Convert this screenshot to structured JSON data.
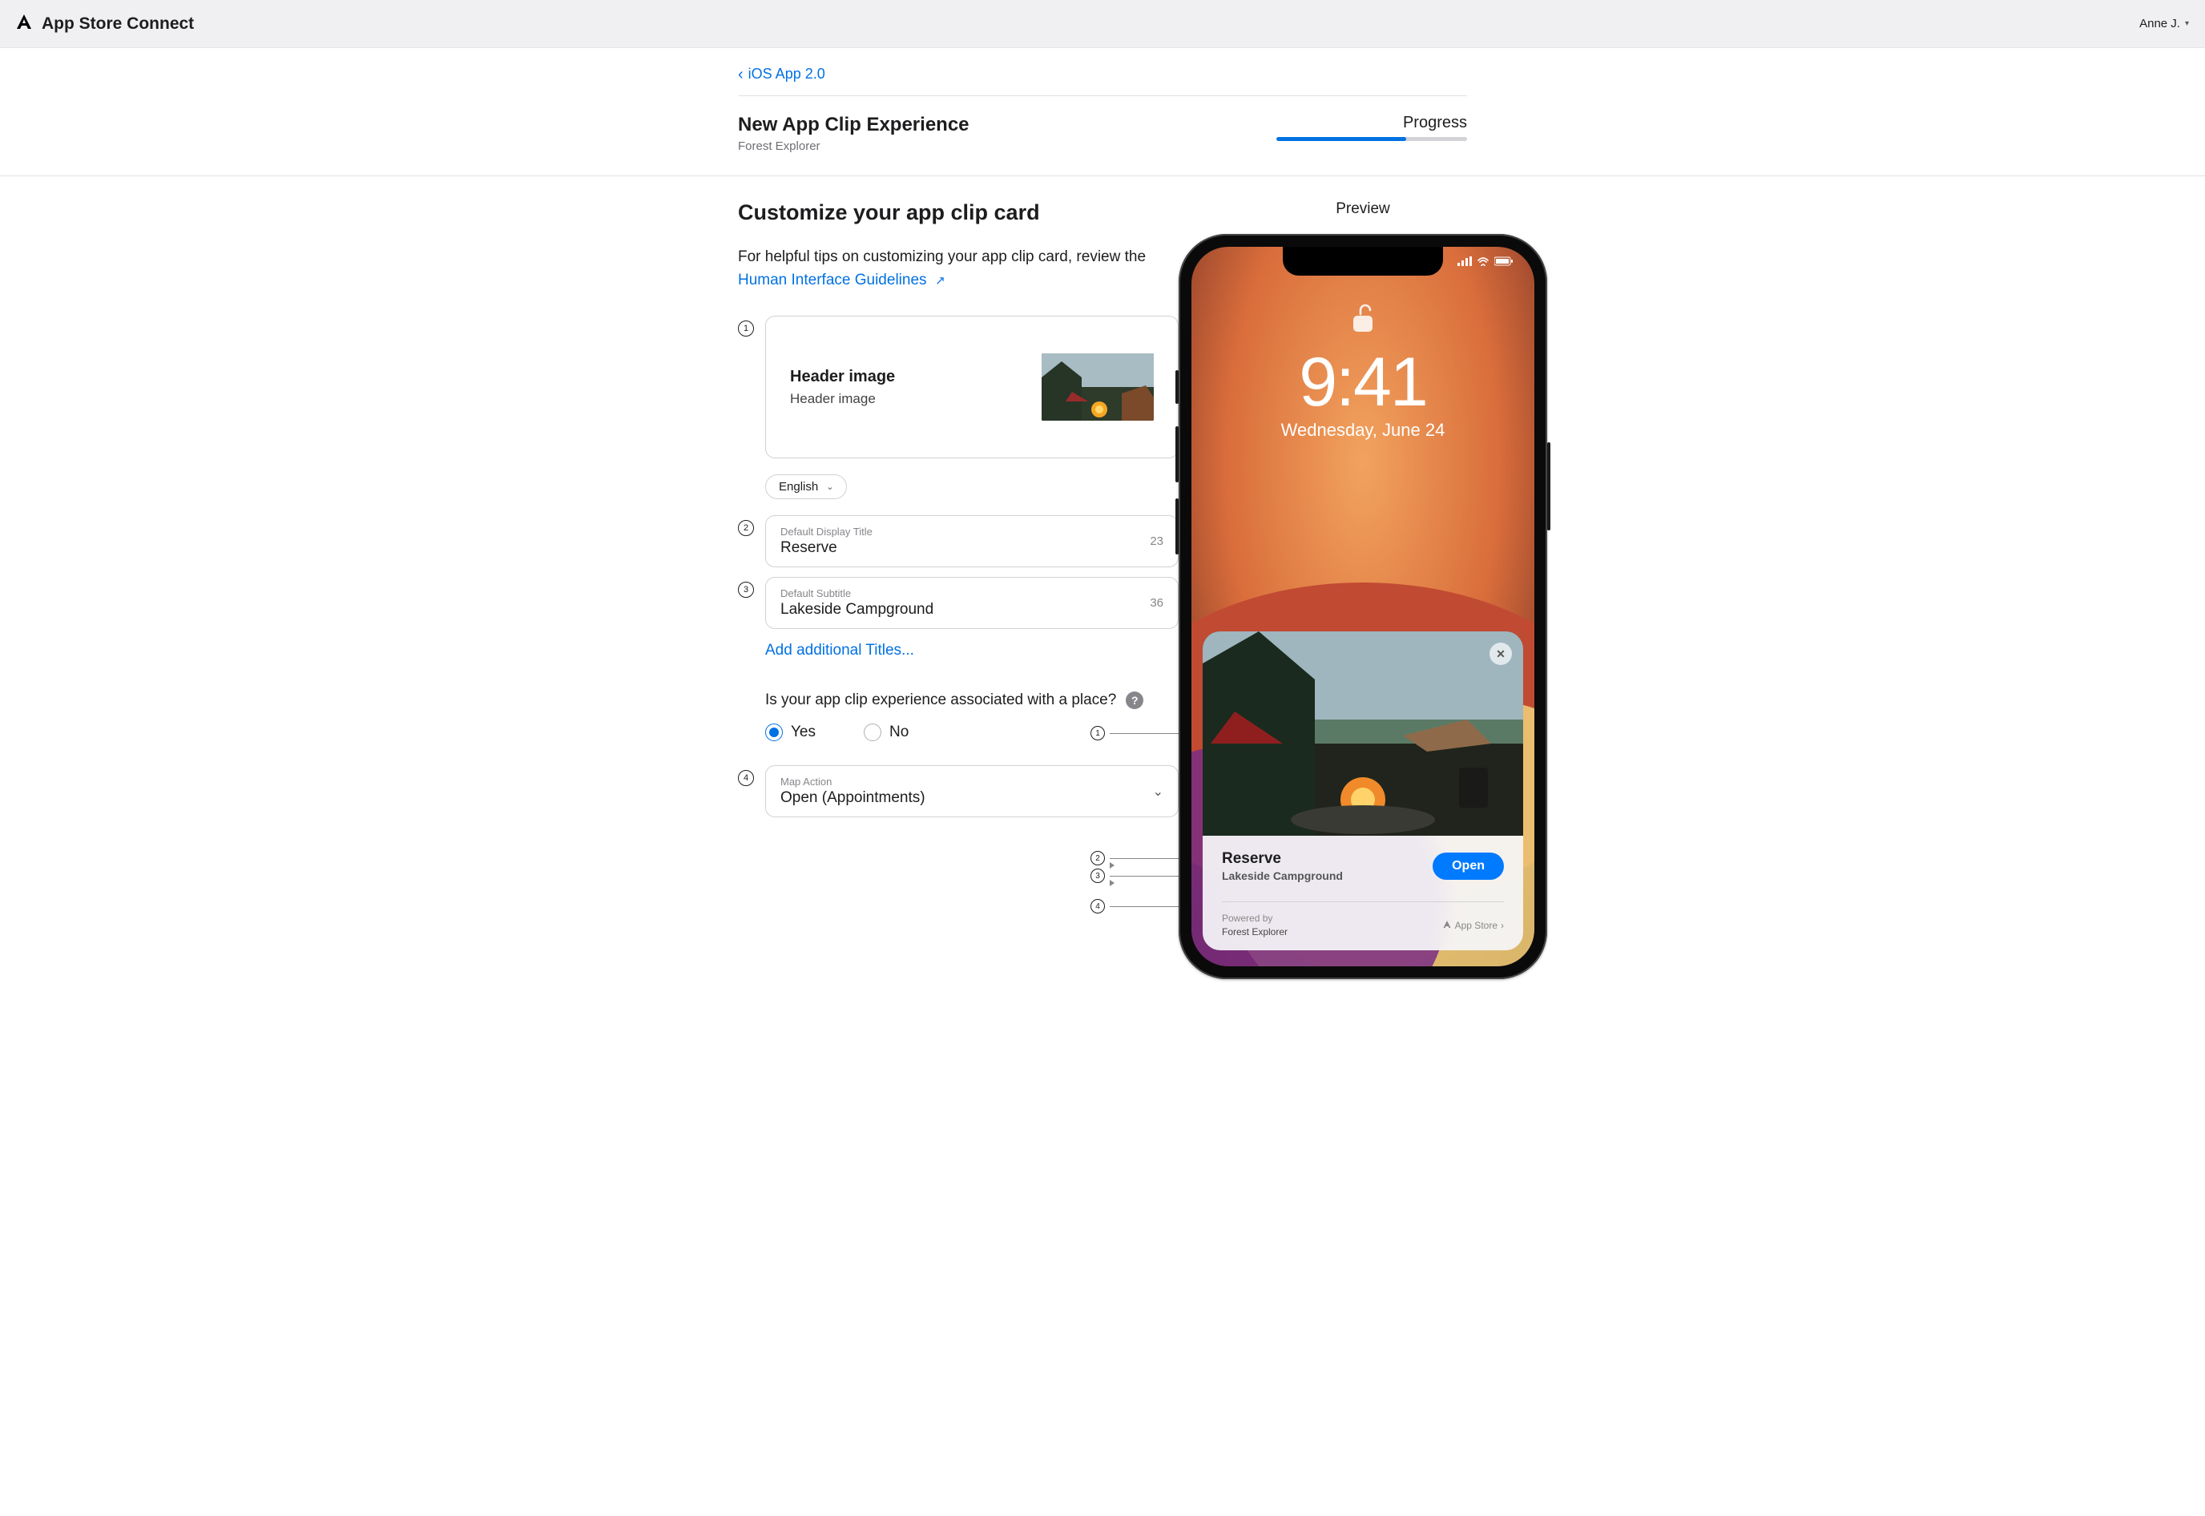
{
  "topbar": {
    "app_name": "App Store Connect",
    "user_name": "Anne J."
  },
  "header": {
    "back_label": "iOS App 2.0",
    "title": "New App Clip Experience",
    "subtitle": "Forest Explorer",
    "progress_label": "Progress",
    "progress_pct": 68
  },
  "form": {
    "section_title": "Customize your app clip card",
    "intro_prefix": "For helpful tips on customizing your app clip card, review the ",
    "intro_link": "Human Interface Guidelines",
    "header_image": {
      "title": "Header image",
      "subtitle": "Header image"
    },
    "language_selected": "English",
    "title_field": {
      "label": "Default Display Title",
      "value": "Reserve",
      "count": "23"
    },
    "subtitle_field": {
      "label": "Default Subtitle",
      "value": "Lakeside Campground",
      "count": "36"
    },
    "add_titles_link": "Add additional Titles...",
    "place_question": "Is your app clip experience associated with a place?",
    "yes_label": "Yes",
    "no_label": "No",
    "place_selected": "yes",
    "map_action": {
      "label": "Map Action",
      "value": "Open (Appointments)"
    }
  },
  "preview": {
    "label": "Preview",
    "lock_time": "9:41",
    "lock_date": "Wednesday, June 24",
    "card_title": "Reserve",
    "card_subtitle": "Lakeside Campground",
    "open_button": "Open",
    "powered_by_label": "Powered by",
    "powered_by_app": "Forest Explorer",
    "app_store_label": "App Store"
  }
}
